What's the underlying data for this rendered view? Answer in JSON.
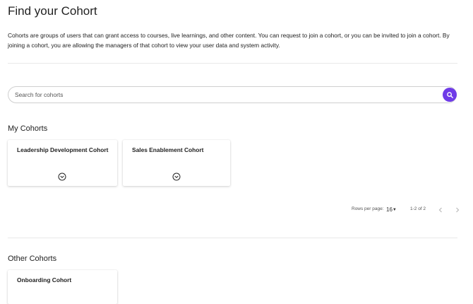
{
  "header": {
    "title": "Find your Cohort",
    "intro": "Cohorts are groups of users that can grant access to courses, live learnings, and other content. You can request to join a cohort, or you can be invited to join a cohort. By joining a cohort, you are allowing the managers of that cohort to view your user data and system activity."
  },
  "search": {
    "placeholder": "Search for cohorts",
    "value": "",
    "icon": "search-icon"
  },
  "my_cohorts": {
    "title": "My Cohorts",
    "cards": [
      {
        "name": "Leadership Development Cohort"
      },
      {
        "name": "Sales Enablement Cohort"
      }
    ]
  },
  "pagination": {
    "rows_label": "Rows per page:",
    "rows_value": "16",
    "range": "1-2 of 2"
  },
  "other_cohorts": {
    "title": "Other Cohorts",
    "cards": [
      {
        "name": "Onboarding Cohort"
      }
    ]
  },
  "colors": {
    "accent": "#6f3be8",
    "divider": "#e8e8e8"
  }
}
